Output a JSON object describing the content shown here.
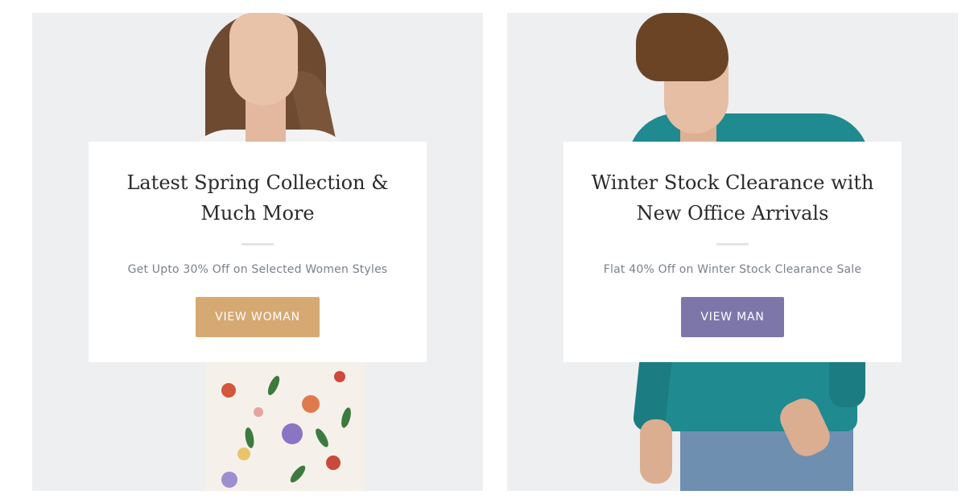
{
  "promos": [
    {
      "title_line1": "Latest Spring Collection &",
      "title_line2": "Much More",
      "subtitle": "Get Upto 30% Off on Selected Women Styles",
      "button_label": "VIEW WOMAN",
      "button_color": "#d6a872",
      "image_icon": "woman-model-image"
    },
    {
      "title_line1": "Winter Stock Clearance with",
      "title_line2": "New Office Arrivals",
      "subtitle": "Flat 40% Off on Winter Stock Clearance Sale",
      "button_label": "VIEW MAN",
      "button_color": "#7d76a8",
      "image_icon": "man-model-image"
    }
  ]
}
